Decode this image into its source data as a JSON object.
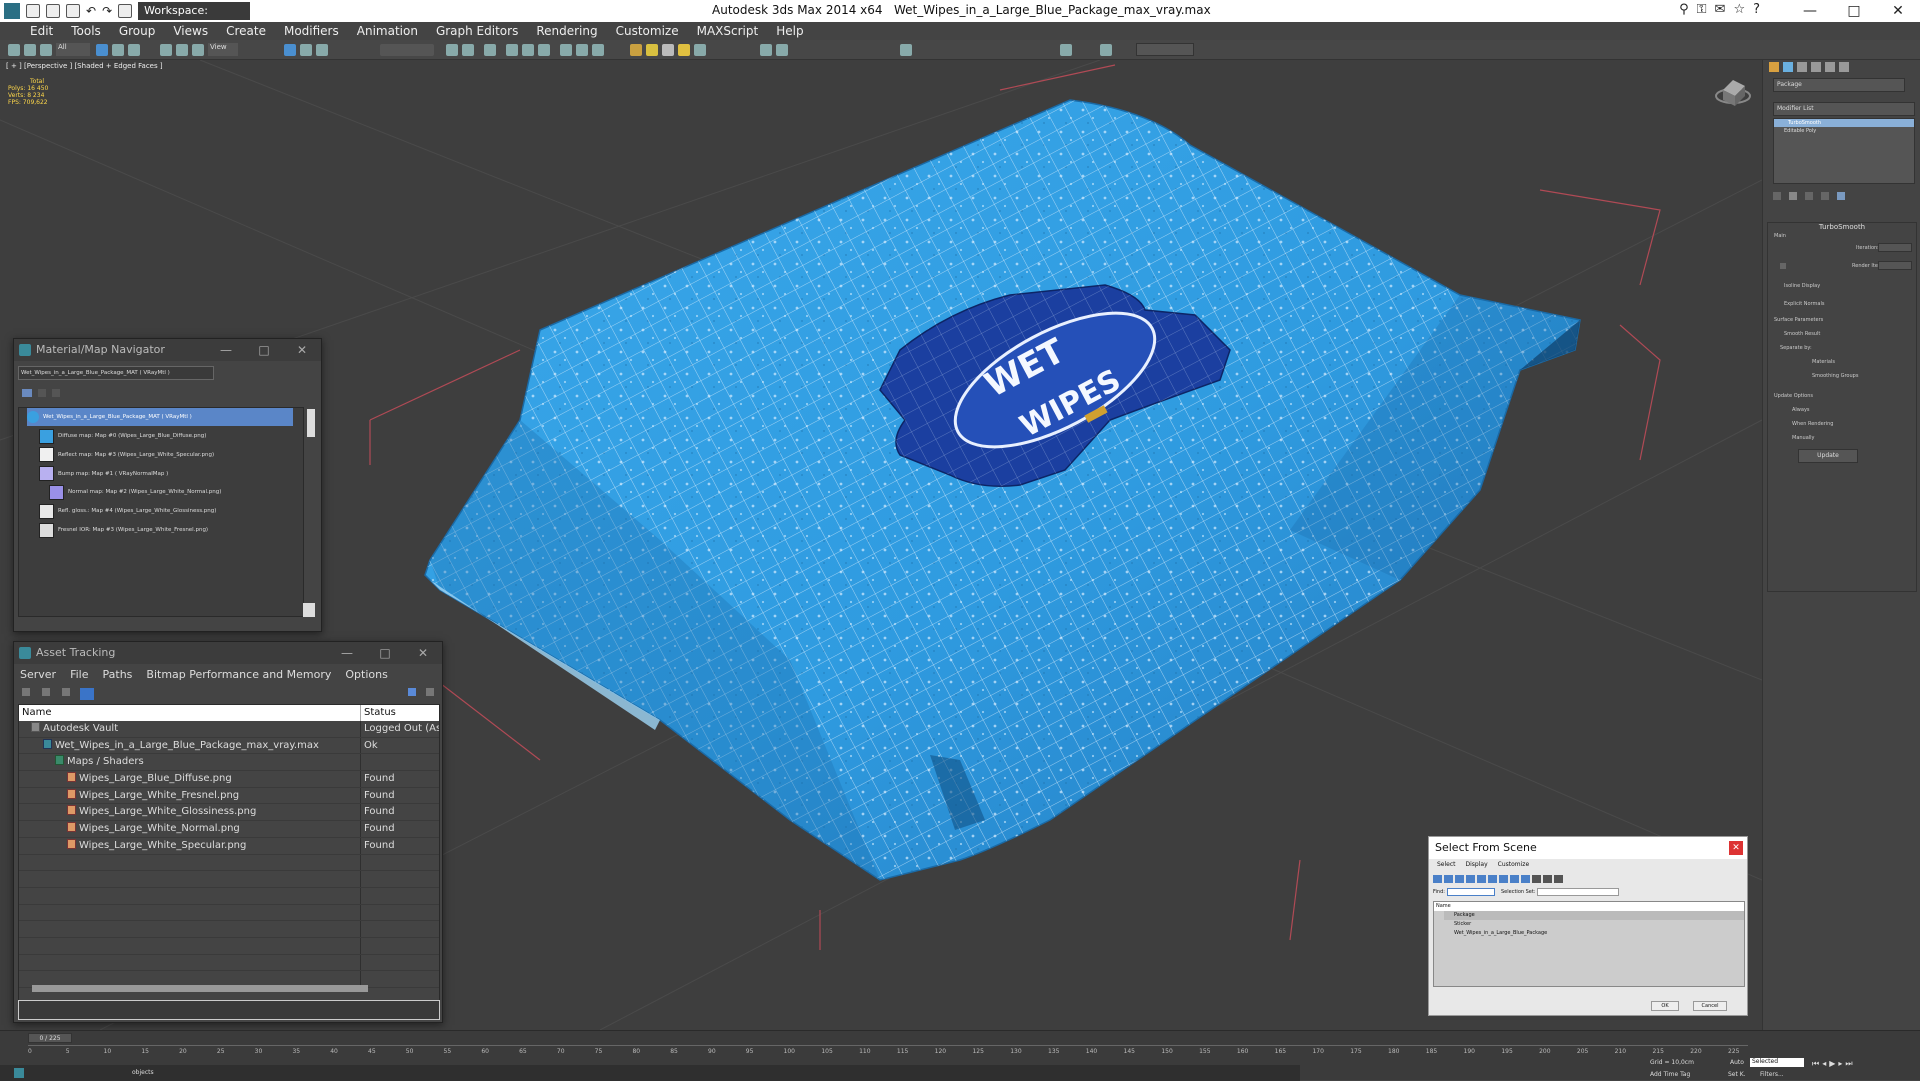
{
  "titlebar": {
    "workspace": "Workspace: Default",
    "app": "Autodesk 3ds Max  2014 x64",
    "file": "Wet_Wipes_in_a_Large_Blue_Package_max_vray.max",
    "window_controls": [
      "—",
      "□",
      "✕"
    ]
  },
  "menu": [
    "Edit",
    "Tools",
    "Group",
    "Views",
    "Create",
    "Modifiers",
    "Animation",
    "Graph Editors",
    "Rendering",
    "Customize",
    "MAXScript",
    "Help"
  ],
  "toolbar": {
    "selection_filter": "All",
    "coord_system": "View"
  },
  "viewport": {
    "label": "[ + ] [Perspective ] [Shaded + Edged Faces ]",
    "stats": [
      "Total",
      "Polys:  16 450",
      "Verts:  8 234",
      "",
      "FPS:    709,622"
    ],
    "package_text": [
      "WET",
      "WIPES"
    ]
  },
  "material_navigator": {
    "title": "Material/Map Navigator",
    "field": "Wet_Wipes_in_a_Large_Blue_Package_MAT  ( VRayMtl )",
    "root": "Wet_Wipes_in_a_Large_Blue_Package_MAT  ( VRayMtl )",
    "maps": [
      {
        "label": "Diffuse map: Map #0 (Wipes_Large_Blue_Diffuse.png)",
        "color": "#3aa0e0"
      },
      {
        "label": "Reflect map: Map #3 (Wipes_Large_White_Specular.png)",
        "color": "#f0f0f0"
      },
      {
        "label": "Bump map: Map #1  ( VRayNormalMap )",
        "color": "#b8b0f0"
      },
      {
        "label": "Normal map: Map #2 (Wipes_Large_White_Normal.png)",
        "color": "#9a90e8"
      },
      {
        "label": "Refl. gloss.: Map #4 (Wipes_Large_White_Glossiness.png)",
        "color": "#e8e8e8"
      },
      {
        "label": "Fresnel IOR: Map #3 (Wipes_Large_White_Fresnel.png)",
        "color": "#dcdcdc"
      }
    ]
  },
  "asset_tracking": {
    "title": "Asset Tracking",
    "menu": [
      "Server",
      "File",
      "Paths",
      "Bitmap Performance and Memory",
      "Options"
    ],
    "columns": [
      "Name",
      "Status"
    ],
    "rows": [
      {
        "name": "Autodesk Vault",
        "status": "Logged Out (Ass...",
        "indent": 1
      },
      {
        "name": "Wet_Wipes_in_a_Large_Blue_Package_max_vray.max",
        "status": "Ok",
        "indent": 2
      },
      {
        "name": "Maps / Shaders",
        "status": "",
        "indent": 3
      },
      {
        "name": "Wipes_Large_Blue_Diffuse.png",
        "status": "Found",
        "indent": 4
      },
      {
        "name": "Wipes_Large_White_Fresnel.png",
        "status": "Found",
        "indent": 4
      },
      {
        "name": "Wipes_Large_White_Glossiness.png",
        "status": "Found",
        "indent": 4
      },
      {
        "name": "Wipes_Large_White_Normal.png",
        "status": "Found",
        "indent": 4
      },
      {
        "name": "Wipes_Large_White_Specular.png",
        "status": "Found",
        "indent": 4
      }
    ]
  },
  "command_panel": {
    "object_name": "Package",
    "modifier_list": "Modifier List",
    "stack": [
      "TurboSmooth",
      "Editable Poly"
    ],
    "turbosmooth": "TurboSmooth",
    "main": "Main",
    "iterations": "Iterations:",
    "render_iters": "Render Iters:",
    "isoline": "Isoline Display",
    "explicit": "Explicit Normals",
    "surface": "Surface Parameters",
    "smooth_result": "Smooth Result",
    "separate_by": "Separate by:",
    "materials": "Materials",
    "smoothing_groups": "Smoothing Groups",
    "update_options": "Update Options",
    "always": "Always",
    "when_rendering": "When Rendering",
    "manually": "Manually",
    "update": "Update"
  },
  "select_from_scene": {
    "title": "Select From Scene",
    "menu": [
      "Select",
      "Display",
      "Customize"
    ],
    "find": "Find:",
    "selection_set": "Selection Set:",
    "column": "Name",
    "items": [
      "Package",
      "Sticker",
      "Wet_Wipes_in_a_Large_Blue_Package"
    ],
    "ok": "OK",
    "cancel": "Cancel"
  },
  "timeline": {
    "frame": "0 / 225",
    "ticks": [
      "0",
      "5",
      "10",
      "15",
      "20",
      "25",
      "30",
      "35",
      "40",
      "45",
      "50",
      "55",
      "60",
      "65",
      "70",
      "75",
      "80",
      "85",
      "90",
      "95",
      "100",
      "105",
      "110",
      "115",
      "120",
      "125",
      "130",
      "135",
      "140",
      "145",
      "150",
      "155",
      "160",
      "165",
      "170",
      "175",
      "180",
      "185",
      "190",
      "195",
      "200",
      "205",
      "210",
      "215",
      "220",
      "225"
    ],
    "grid": "Grid = 10,0cm",
    "auto": "Auto",
    "selected": "Selected",
    "set_key": "Set K.",
    "filters": "Filters...",
    "add_time_tag": "Add Time Tag",
    "objects": "objects"
  },
  "colors": {
    "package_blue": "#2f9be0",
    "label_navy": "#1b3fa0",
    "grid_red": "#b04a55"
  }
}
